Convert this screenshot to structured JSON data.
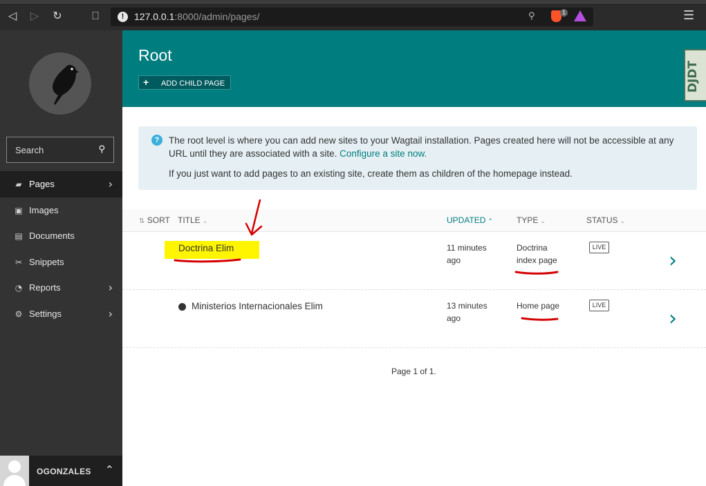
{
  "browser": {
    "url_host": "127.0.0.1",
    "url_rest": ":8000/admin/pages/",
    "brave_badge": "1"
  },
  "sidebar": {
    "search_label": "Search",
    "items": [
      {
        "label": "Pages",
        "icon": "folder-icon",
        "active": true,
        "has_arrow": true
      },
      {
        "label": "Images",
        "icon": "image-icon",
        "active": false,
        "has_arrow": false
      },
      {
        "label": "Documents",
        "icon": "doc-icon",
        "active": false,
        "has_arrow": false
      },
      {
        "label": "Snippets",
        "icon": "snippet-icon",
        "active": false,
        "has_arrow": false
      },
      {
        "label": "Reports",
        "icon": "reports-icon",
        "active": false,
        "has_arrow": true
      },
      {
        "label": "Settings",
        "icon": "cogs-icon",
        "active": false,
        "has_arrow": true
      }
    ],
    "account_name": "OGONZALES"
  },
  "header": {
    "title": "Root",
    "add_child_label": "ADD CHILD PAGE",
    "debug_toolbar_label": "DJDT"
  },
  "info": {
    "line1": "The root level is where you can add new sites to your Wagtail installation. Pages created here will not be accessible at any URL until they are associated with a site.",
    "link": "Configure a site now.",
    "line2": "If you just want to add pages to an existing site, create them as children of the homepage instead."
  },
  "listing": {
    "columns": {
      "sort": "SORT",
      "title": "TITLE",
      "updated": "UPDATED",
      "type": "TYPE",
      "status": "STATUS"
    },
    "rows": [
      {
        "title": "Doctrina Elim",
        "updated_1": "11 minutes",
        "updated_2": "ago",
        "type_1": "Doctrina",
        "type_2": "index page",
        "status": "LIVE"
      },
      {
        "title": "Ministerios Internacionales Elim",
        "updated_1": "13 minutes",
        "updated_2": "ago",
        "type_1": "Home page",
        "type_2": "",
        "status": "LIVE"
      }
    ]
  },
  "pagination": "Page 1 of 1.",
  "colors": {
    "teal": "#007d7e",
    "sidebar": "#333333",
    "highlight": "#fff500",
    "annotation": "#d40000"
  }
}
